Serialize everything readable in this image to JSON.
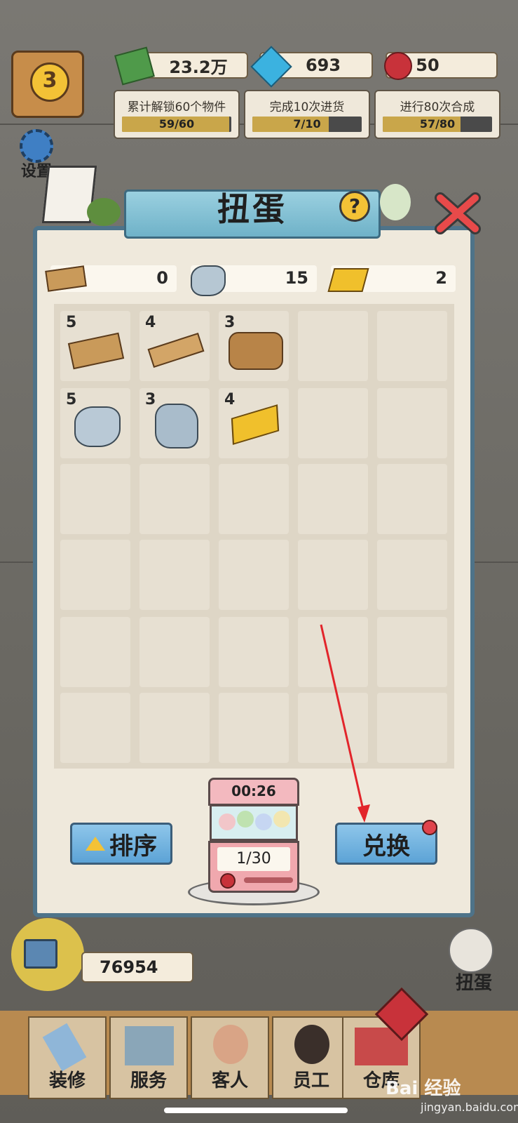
{
  "hud": {
    "level": "3",
    "money": "23.2万",
    "gems": "693",
    "roses": "50"
  },
  "tasks": [
    {
      "title": "累计解锁60个物件",
      "progress": "59/60",
      "fraction": 0.983
    },
    {
      "title": "完成10次进货",
      "progress": "7/10",
      "fraction": 0.7
    },
    {
      "title": "进行80次合成",
      "progress": "57/80",
      "fraction": 0.7125
    }
  ],
  "side_menu": {
    "settings": "设置"
  },
  "dialog": {
    "title": "扭蛋",
    "help": "?",
    "resources": [
      {
        "icon": "wood-plank-icon",
        "value": "0"
      },
      {
        "icon": "stone-icon",
        "value": "15"
      },
      {
        "icon": "gold-bar-icon",
        "value": "2"
      }
    ],
    "items": [
      {
        "icon": "wood-planks-icon",
        "count": "5"
      },
      {
        "icon": "wood-plank-icon",
        "count": "4"
      },
      {
        "icon": "logs-icon",
        "count": "3"
      },
      {
        "icon": "stone-icon",
        "count": "5"
      },
      {
        "icon": "rock-pile-icon",
        "count": "3"
      },
      {
        "icon": "gold-bar-icon",
        "count": "4"
      }
    ],
    "sort_button": "排序",
    "exchange_button": "兑换",
    "machine_timer": "00:26",
    "machine_count": "1/30"
  },
  "video_reward": "76954",
  "right_side": {
    "gacha_label": "扭蛋"
  },
  "bottom_nav": [
    "装修",
    "服务",
    "客人",
    "员工",
    "仓库"
  ],
  "watermark": {
    "logo": "Bai 经验",
    "url": "jingyan.baidu.com"
  },
  "colors": {
    "dialog_border": "#4e7389",
    "button_blue": "#5ca3d6",
    "progress_fill": "#c9a64a"
  }
}
